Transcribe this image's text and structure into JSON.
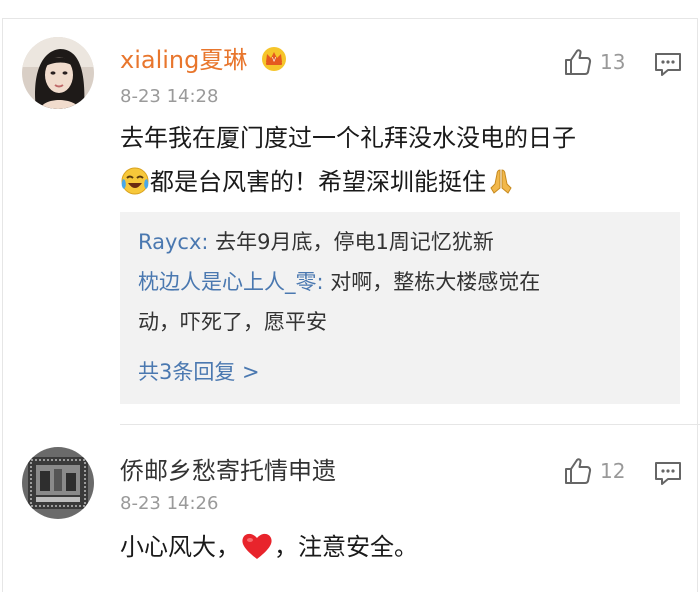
{
  "comments": [
    {
      "avatar": "woman-portrait-avatar",
      "username": "xialing夏琳",
      "badge": "vip-crown-icon",
      "time": "8-23 14:28",
      "likes": "13",
      "content_line1": "去年我在厦门度过一个礼拜没水没电的日子",
      "content_line2": "都是台风害的！希望深圳能挺住",
      "replies": [
        {
          "author": "Raycx",
          "separator": ": ",
          "text": "去年9月底，停电1周记忆犹新"
        },
        {
          "author": "枕边人是心上人_零",
          "separator": ": ",
          "text_line1": "对啊，整栋大楼感觉在",
          "text_line2": "动，吓死了，愿平安"
        }
      ],
      "more_replies": "共3条回复 >"
    },
    {
      "avatar": "stamp-avatar",
      "username": "侨邮乡愁寄托情申遗",
      "time": "8-23 14:26",
      "likes": "12",
      "content_before": "小心风大，",
      "content_after": "，注意安全。"
    }
  ],
  "colors": {
    "vip_name": "#e8762d",
    "link": "#4a78b0",
    "meta": "#9a9a9a",
    "reply_bg": "#f2f2f2"
  }
}
